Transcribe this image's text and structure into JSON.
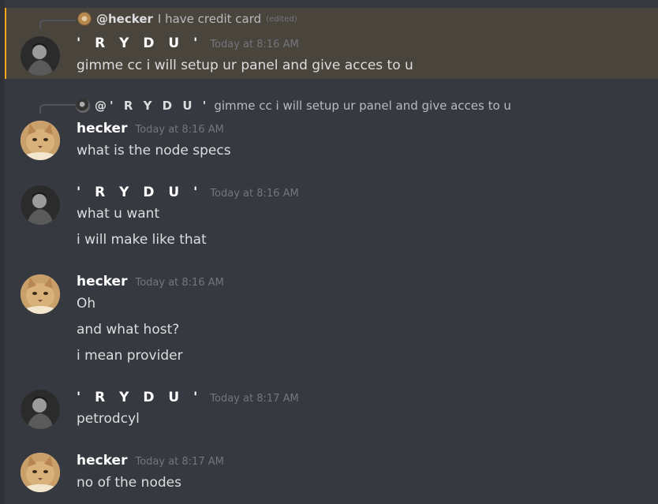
{
  "messages": [
    {
      "reply": {
        "name": "@hecker",
        "text": "I have credit card",
        "edited": "(edited)"
      },
      "author": "' R Y D U '",
      "time": "Today at 8:16 AM",
      "lines": [
        "gimme cc i will setup ur panel and give acces to u"
      ]
    },
    {
      "reply": {
        "name": "@' R Y D U '",
        "text": "gimme cc i will setup ur panel and give acces to u"
      },
      "author": "hecker",
      "time": "Today at 8:16 AM",
      "lines": [
        "what is the node specs"
      ]
    },
    {
      "author": "' R Y D U '",
      "time": "Today at 8:16 AM",
      "lines": [
        "what u want",
        "i will make like that"
      ]
    },
    {
      "author": "hecker",
      "time": "Today at 8:16 AM",
      "lines": [
        "Oh",
        "and what host?",
        "i mean provider"
      ]
    },
    {
      "author": "' R Y D U '",
      "time": "Today at 8:17 AM",
      "lines": [
        "petrodcyl"
      ]
    },
    {
      "author": "hecker",
      "time": "Today at 8:17 AM",
      "lines": [
        "no of the nodes"
      ]
    }
  ],
  "icons": {
    "rydu_avatar": "user-avatar-icon",
    "hecker_avatar": "cat-avatar-icon"
  },
  "colors": {
    "background": "#36393f",
    "highlight": "#49443c",
    "highlight_border": "#faa61a",
    "timestamp": "#72767d"
  }
}
